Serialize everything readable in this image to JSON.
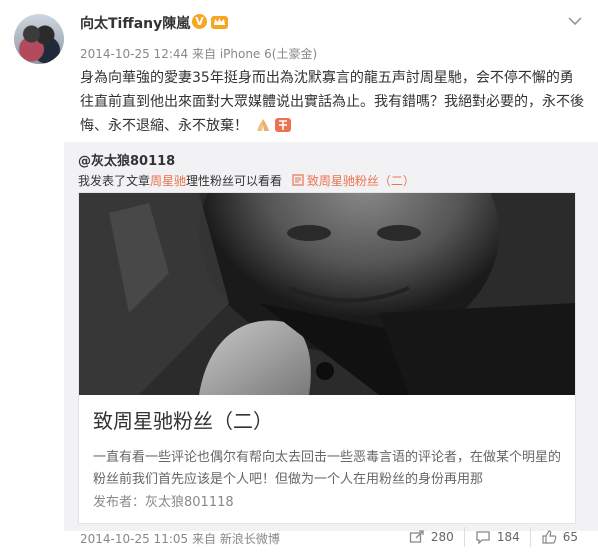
{
  "post": {
    "username": "向太Tiffany陳嵐",
    "verified_badge": "V",
    "meta": {
      "time": "2014-10-25 12:44",
      "from_label": "来自",
      "source": "iPhone 6(土豪金)"
    },
    "content": "身為向華強的愛妻35年挺身而出為沈默寡言的龍五声討周星馳，会不停不懈的勇往直前直到他出來面對大眾媒體说出實話為止。我有錯嗎？我絕對必要的，永不後悔、永不退縮、永不放棄！",
    "icons": {
      "avatar": "avatar-photo",
      "menu": "chevron-down-icon",
      "crown": "crown-icon",
      "emoji_1": "pray-hands-icon",
      "emoji_2": "cheer-icon"
    }
  },
  "repost": {
    "user": "@灰太狼80118",
    "text_prefix": "我发表了文章",
    "text_highlight": "周星驰",
    "text_suffix": "理性粉丝可以看看",
    "link_text": "致周星驰粉丝（二）",
    "card": {
      "title": "致周星驰粉丝（二）",
      "description": "一直有看一些评论也偶尔有帮向太去回击一些恶毒言语的评论者，在做某个明星的粉丝前我们首先应该是个人吧！但做为一个人在用粉丝的身份再用那",
      "author": "发布者：灰太狼801118"
    },
    "footer": {
      "time": "2014-10-25 11:05",
      "from_label": "来自",
      "source": "新浪长微博"
    },
    "actions": [
      {
        "icon": "share-icon",
        "count": "280"
      },
      {
        "icon": "comment-icon",
        "count": "184"
      },
      {
        "icon": "like-icon",
        "count": "65"
      }
    ]
  },
  "colors": {
    "accent": "#eb7350",
    "badge": "#f6a623",
    "repost_bg": "#f2f2f5"
  }
}
